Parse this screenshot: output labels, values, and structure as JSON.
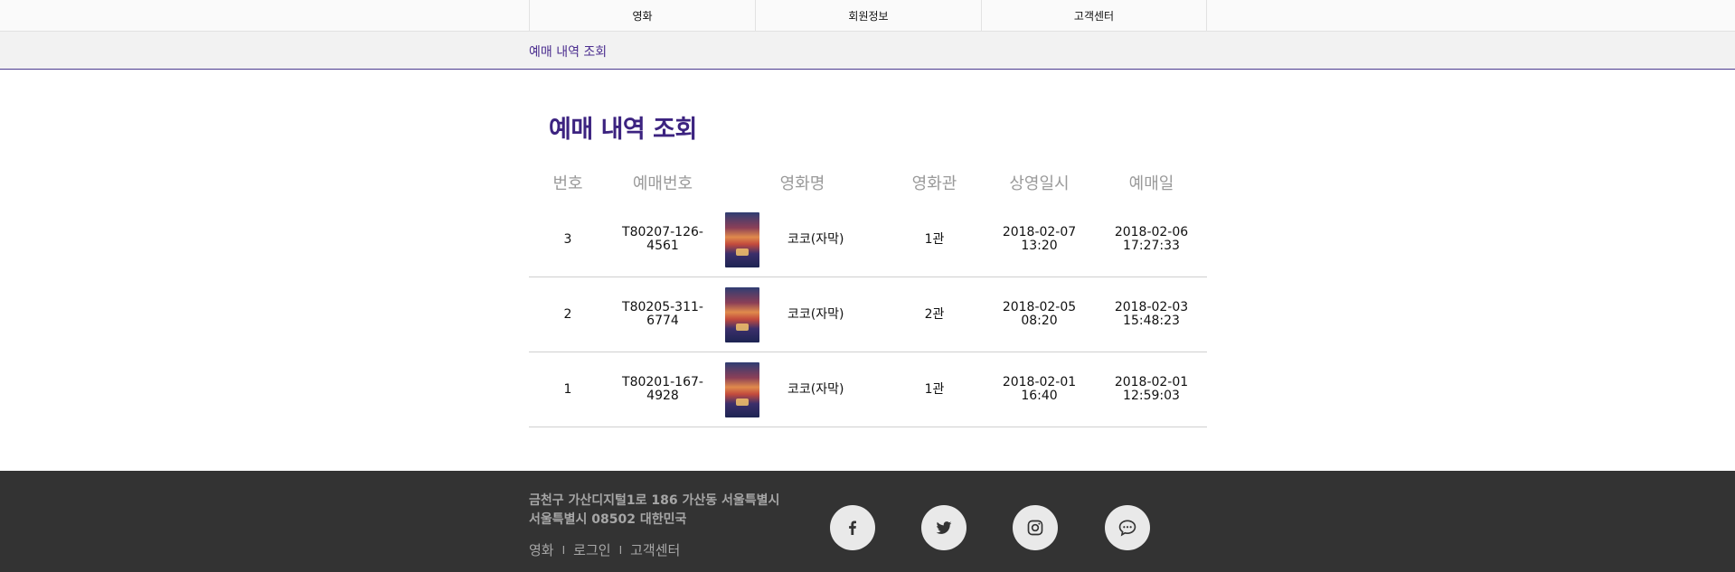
{
  "nav": {
    "items": [
      {
        "label": "영화"
      },
      {
        "label": "회원정보"
      },
      {
        "label": "고객센터"
      }
    ]
  },
  "breadcrumb": "예매 내역 조회",
  "page_title": "예매 내역 조회",
  "table": {
    "headers": [
      "번호",
      "예매번호",
      "영화명",
      "영화관",
      "상영일시",
      "예매일"
    ],
    "rows": [
      {
        "no": "3",
        "reservation": "T80207-126-4561",
        "movie": "코코(자막)",
        "hall": "1관",
        "show_date": "2018-02-07",
        "show_time": "13:20",
        "booked_date": "2018-02-06",
        "booked_time": "17:27:33"
      },
      {
        "no": "2",
        "reservation": "T80205-311-6774",
        "movie": "코코(자막)",
        "hall": "2관",
        "show_date": "2018-02-05",
        "show_time": "08:20",
        "booked_date": "2018-02-03",
        "booked_time": "15:48:23"
      },
      {
        "no": "1",
        "reservation": "T80201-167-4928",
        "movie": "코코(자막)",
        "hall": "1관",
        "show_date": "2018-02-01",
        "show_time": "16:40",
        "booked_date": "2018-02-01",
        "booked_time": "12:59:03"
      }
    ]
  },
  "footer": {
    "address_line1": "금천구 가산디지털1로 186 가산동 서울특별시",
    "address_line2": "서울특별시 08502 대한민국",
    "links": [
      "영화",
      "로그인",
      "고객센터"
    ],
    "separator": "I",
    "social": [
      {
        "icon": "facebook-icon"
      },
      {
        "icon": "twitter-icon"
      },
      {
        "icon": "instagram-icon"
      },
      {
        "icon": "chat-icon"
      }
    ]
  },
  "colors": {
    "accent": "#3c2380",
    "footer_bg": "#333333"
  }
}
